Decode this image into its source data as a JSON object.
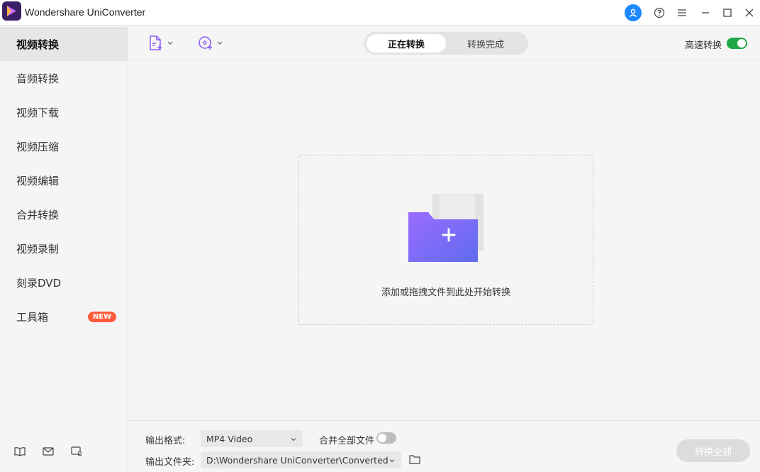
{
  "window": {
    "title": "Wondershare UniConverter"
  },
  "sidebar": {
    "items": [
      {
        "label": "视频转换",
        "active": true
      },
      {
        "label": "音频转换"
      },
      {
        "label": "视频下载"
      },
      {
        "label": "视频压缩"
      },
      {
        "label": "视频编辑"
      },
      {
        "label": "合并转换"
      },
      {
        "label": "视频录制"
      },
      {
        "label": "刻录DVD"
      },
      {
        "label": "工具箱",
        "badge": "NEW"
      }
    ]
  },
  "toolbar": {
    "tabs": [
      {
        "label": "正在转换",
        "active": true
      },
      {
        "label": "转换完成"
      }
    ],
    "high_speed_label": "高速转换",
    "high_speed_enabled": true
  },
  "dropzone": {
    "text": "添加或拖拽文件到此处开始转换"
  },
  "bottom": {
    "format_label": "输出格式:",
    "format_value": "MP4 Video",
    "merge_label": "合并全部文件",
    "merge_enabled": false,
    "folder_label": "输出文件夹:",
    "folder_value": "D:\\Wondershare UniConverter\\Converted",
    "convert_all_label": "转换全部"
  },
  "colors": {
    "accent_blue": "#1e88ff",
    "toggle_green": "#1ea846",
    "badge_red": "#ff5a3c",
    "folder_purple": "#7b61ff"
  }
}
